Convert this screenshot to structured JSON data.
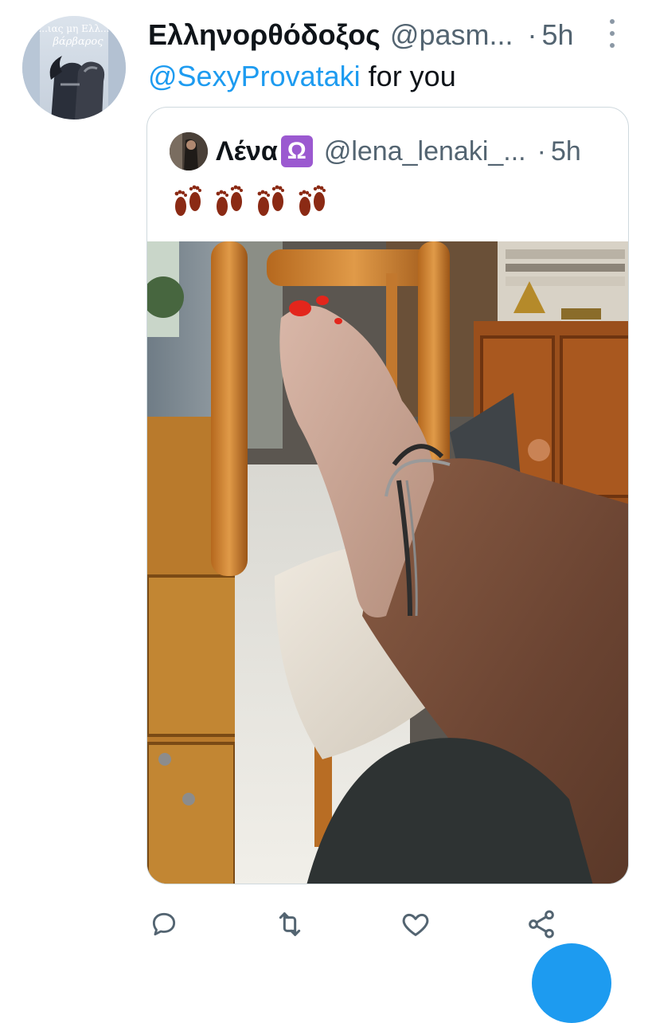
{
  "tweet": {
    "display_name": "Ελληνορθόδοξος",
    "handle": "@pasm...",
    "separator": "·",
    "time": "5h",
    "mention": "@SexyProvataki",
    "text_after_mention": "for you",
    "avatar_lettering": [
      "...ιας μη Ελλ...",
      "βάρβαρος"
    ]
  },
  "quoted_tweet": {
    "display_name": "Λένα",
    "zodiac_icon": "libra-icon",
    "zodiac_glyph": "Ω",
    "handle": "@lena_lenaki_...",
    "separator": "·",
    "time": "5h",
    "emoji": [
      "footprints",
      "footprints",
      "footprints",
      "footprints"
    ]
  },
  "actions": {
    "icons": [
      "reply-icon",
      "retweet-icon",
      "like-icon",
      "share-icon"
    ]
  },
  "colors": {
    "accent": "#1d9bf0",
    "secondary_text": "#536471",
    "border": "#cfd9de",
    "icon": "#536471"
  }
}
